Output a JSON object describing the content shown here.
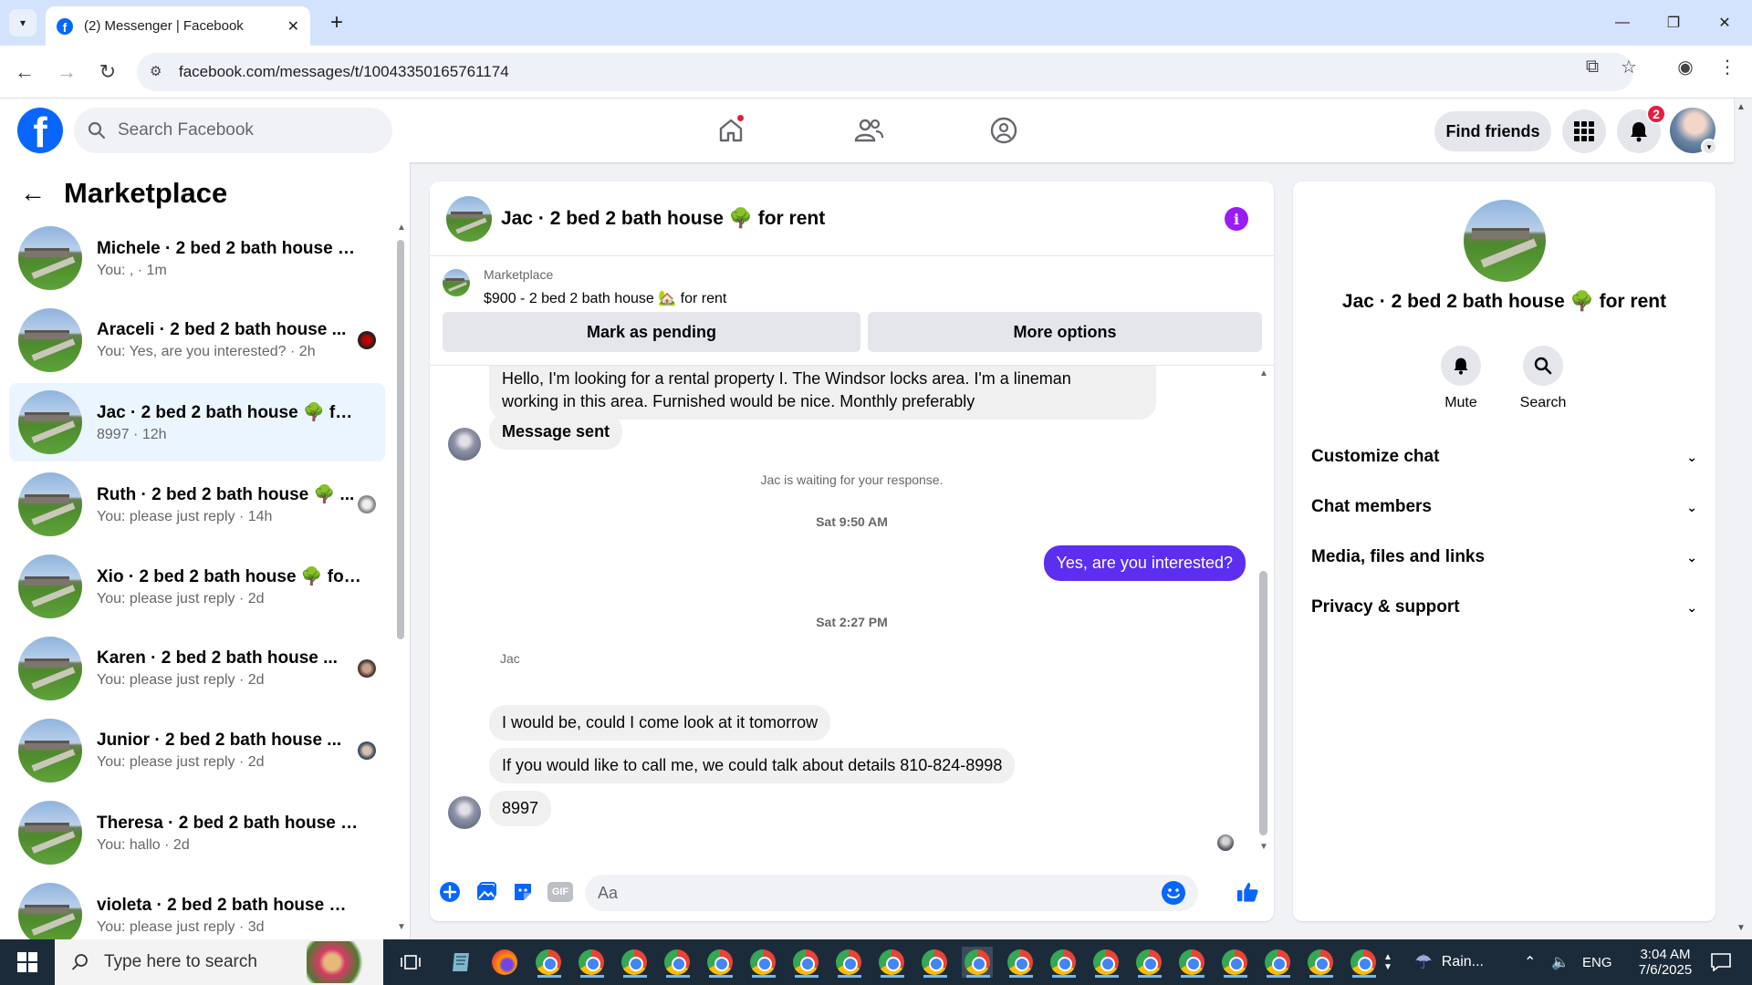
{
  "browser": {
    "tab_title": "(2) Messenger | Facebook",
    "url": "facebook.com/messages/t/10043350165761174"
  },
  "fb_header": {
    "logo_letter": "f",
    "search_placeholder": "Search Facebook",
    "find_friends_label": "Find friends",
    "notifications_count": "2"
  },
  "left_panel": {
    "title": "Marketplace",
    "conversations": [
      {
        "name": "Michele · 2 bed 2 bath house 🌳...",
        "preview": "You: , · 1m"
      },
      {
        "name": "Araceli · 2 bed 2 bath house ...",
        "preview": "You: Yes, are you interested? · 2h"
      },
      {
        "name": "Jac · 2 bed 2 bath house 🌳 for r...",
        "preview": "8997 · 12h"
      },
      {
        "name": "Ruth · 2 bed 2 bath house 🌳 ...",
        "preview": "You: please just reply · 14h"
      },
      {
        "name": "Xio · 2 bed 2 bath house 🌳 for r...",
        "preview": "You: please just reply · 2d"
      },
      {
        "name": "Karen · 2 bed 2 bath house ...",
        "preview": "You: please just reply · 2d"
      },
      {
        "name": "Junior · 2 bed 2 bath house ...",
        "preview": "You: please just reply · 2d"
      },
      {
        "name": "Theresa · 2 bed 2 bath house 🌳...",
        "preview": "You: hallo · 2d"
      },
      {
        "name": "violeta · 2 bed 2 bath house 🌳 f...",
        "preview": "You: please just reply · 3d"
      }
    ]
  },
  "chat": {
    "title": "Jac · 2 bed 2 bath house 🌳 for rent",
    "listing_source": "Marketplace",
    "listing_price": "$900 - 2 bed 2 bath house 🏡 for rent",
    "mark_pending_label": "Mark as pending",
    "more_options_label": "More options",
    "messages": {
      "m1_line1": "Hello, I'm looking for a rental property I. The Windsor locks area. I'm a lineman",
      "m1_line2": "working in this area. Furnished would be nice. Monthly preferably",
      "m2": "Message sent",
      "waiting": "Jac is waiting for your response.",
      "time1": "Sat 9:50 AM",
      "m3": "Yes, are you interested?",
      "time2": "Sat 2:27 PM",
      "sender": "Jac",
      "m4": "I would be, could I come look at it tomorrow",
      "m5": "If you would like to call me, we could talk about details 810-824-8998",
      "m6": "8997"
    },
    "composer_placeholder": "Aa",
    "gif_label": "GIF",
    "outgoing_color": "#5b2ef0"
  },
  "info_panel": {
    "title": "Jac · 2 bed 2 bath house 🌳 for rent",
    "mute_label": "Mute",
    "search_label": "Search",
    "rows": [
      "Customize chat",
      "Chat members",
      "Media, files and links",
      "Privacy & support"
    ]
  },
  "taskbar": {
    "search_placeholder": "Type here to search",
    "weather": "Rain...",
    "language": "ENG",
    "time": "3:04 AM",
    "date": "7/6/2025"
  },
  "colors": {
    "fb_blue": "#0866ff",
    "notification_red": "#e41e3f",
    "active_conversation_bg": "#ebf5ff",
    "info_button": "#9b1bf4"
  }
}
